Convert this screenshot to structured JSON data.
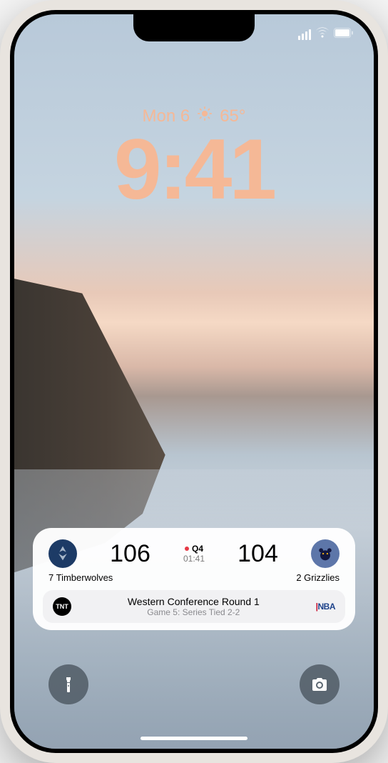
{
  "status": {
    "signal": "full",
    "wifi": "connected",
    "battery": "full"
  },
  "datetime": {
    "date": "Mon 6",
    "weather_icon": "sun-icon",
    "temperature": "65°",
    "time": "9:41"
  },
  "widget": {
    "team1": {
      "seed_name": "7 Timberwolves",
      "score": "106",
      "logo": "timberwolves-logo",
      "color": "#1d3b66"
    },
    "team2": {
      "seed_name": "2 Grizzlies",
      "score": "104",
      "logo": "grizzlies-logo",
      "color": "#5d76a9"
    },
    "quarter": "Q4",
    "clock": "01:41",
    "network": "TNT",
    "series_title": "Western Conference Round 1",
    "series_sub": "Game 5: Series Tied 2-2",
    "league": "NBA"
  },
  "buttons": {
    "flashlight": "flashlight",
    "camera": "camera"
  }
}
